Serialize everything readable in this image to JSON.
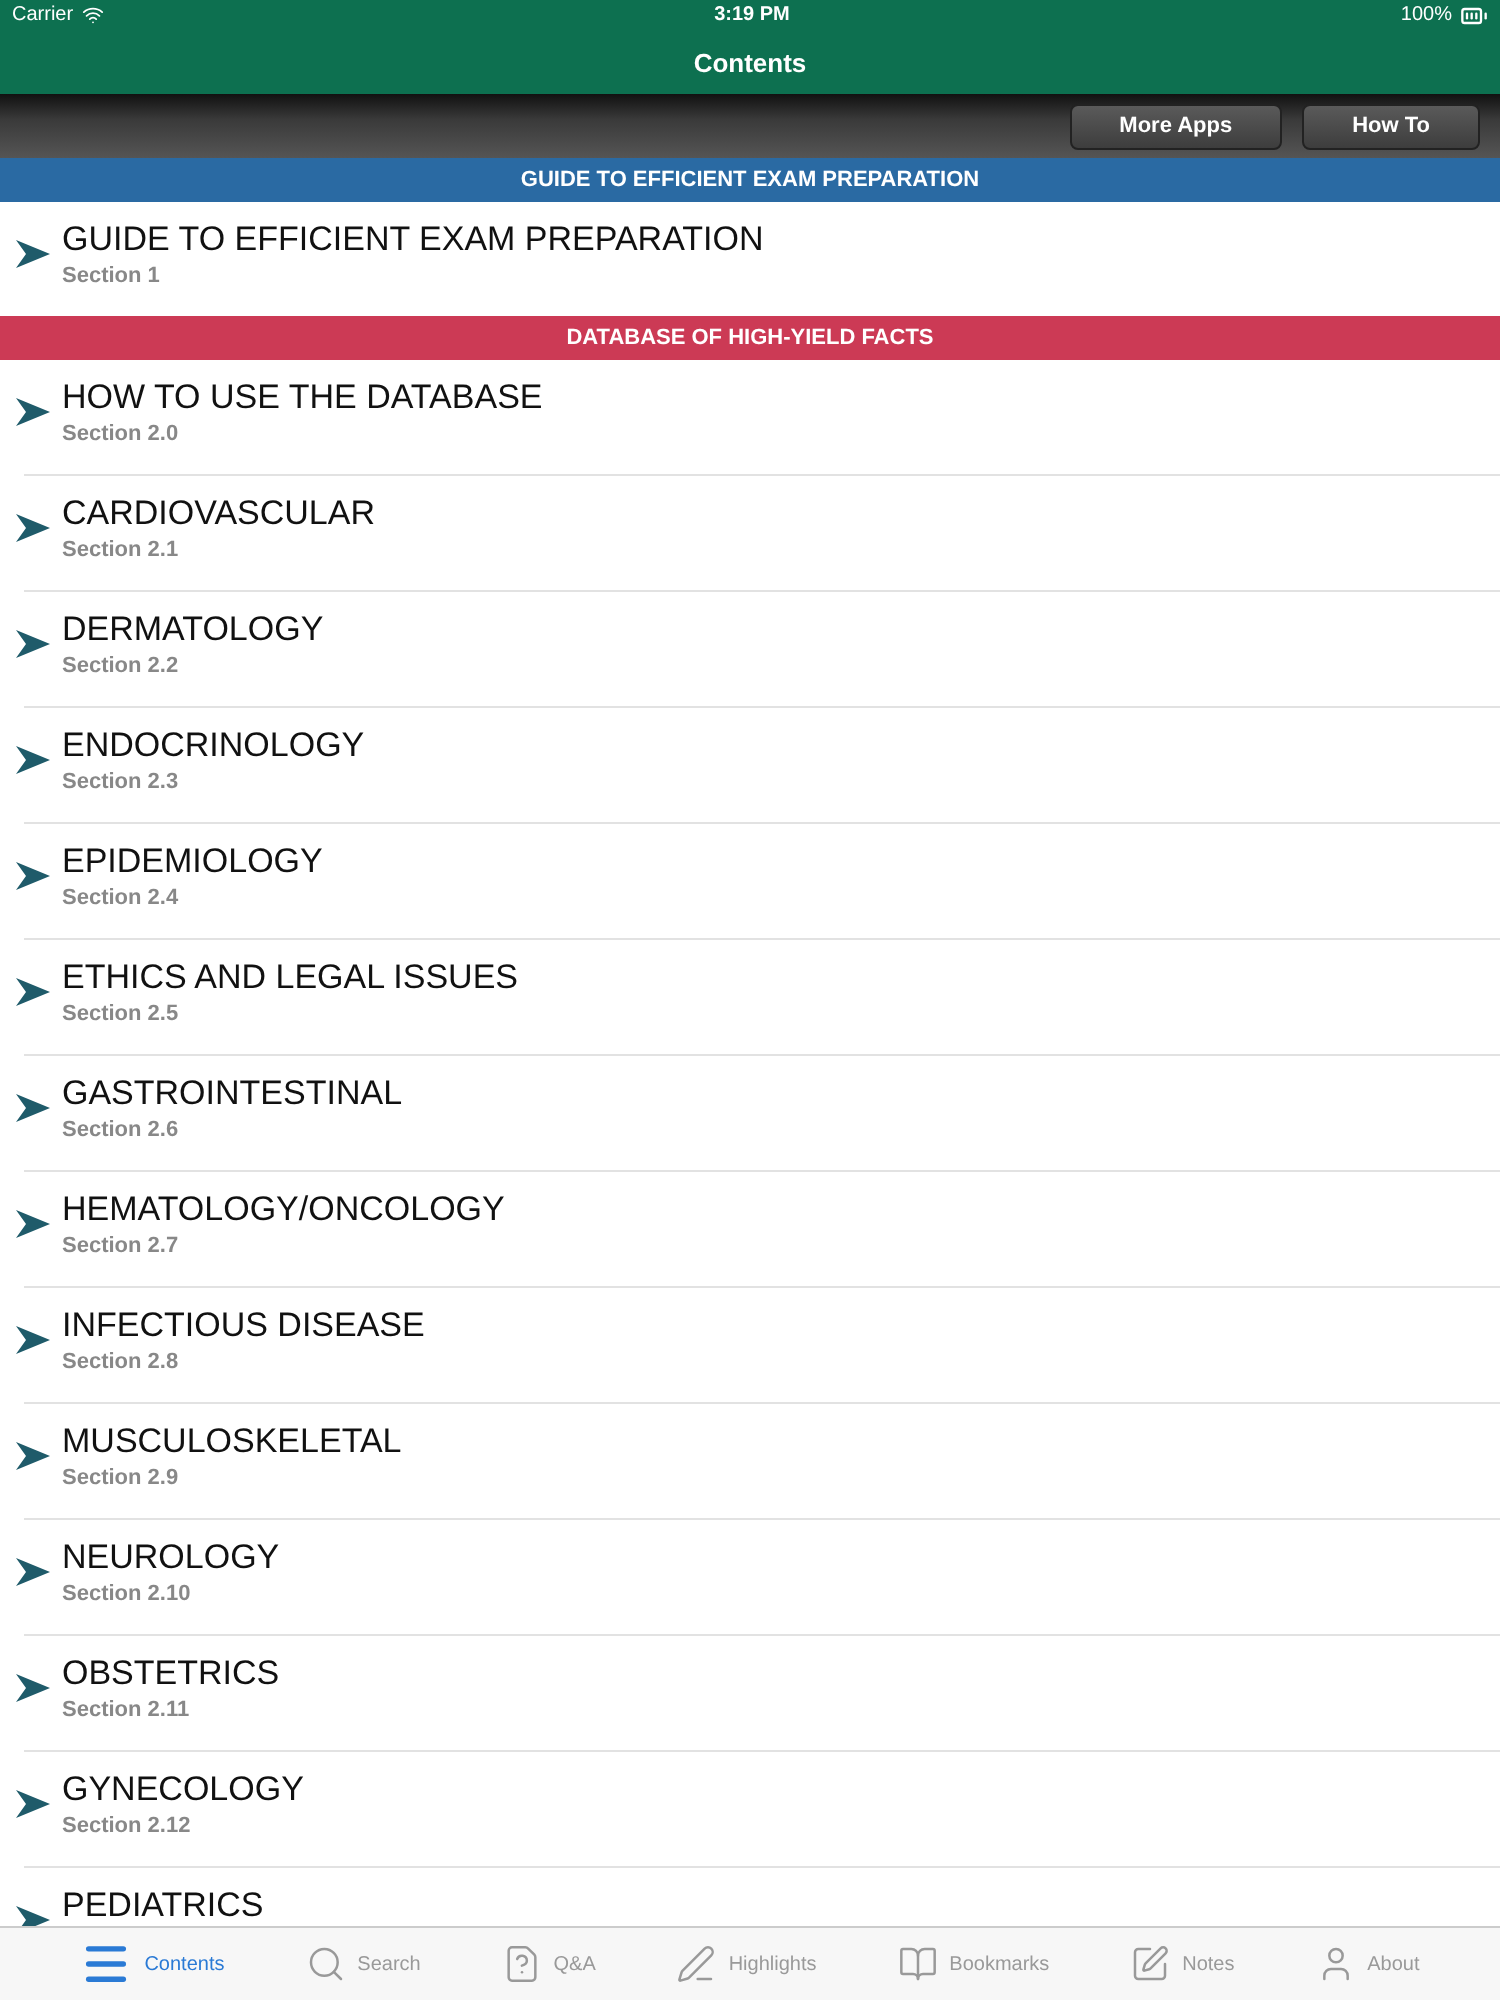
{
  "status_bar": {
    "carrier": "Carrier",
    "time": "3:19 PM",
    "battery": "100%"
  },
  "nav": {
    "title": "Contents"
  },
  "toolbar": {
    "buttons": [
      "More Apps",
      "How To"
    ]
  },
  "sections": [
    {
      "header": "GUIDE TO EFFICIENT EXAM PREPARATION",
      "color": "#2a6aa3",
      "items": [
        {
          "title": "GUIDE TO EFFICIENT EXAM PREPARATION",
          "subtitle": "Section 1"
        }
      ]
    },
    {
      "header": "DATABASE OF HIGH-YIELD FACTS",
      "color": "#cc3a55",
      "items": [
        {
          "title": "HOW TO USE THE DATABASE",
          "subtitle": "Section 2.0"
        },
        {
          "title": "CARDIOVASCULAR",
          "subtitle": "Section 2.1"
        },
        {
          "title": "DERMATOLOGY",
          "subtitle": "Section 2.2"
        },
        {
          "title": "ENDOCRINOLOGY",
          "subtitle": "Section 2.3"
        },
        {
          "title": "EPIDEMIOLOGY",
          "subtitle": "Section 2.4"
        },
        {
          "title": "ETHICS AND LEGAL ISSUES",
          "subtitle": "Section 2.5"
        },
        {
          "title": "GASTROINTESTINAL",
          "subtitle": "Section 2.6"
        },
        {
          "title": "HEMATOLOGY/ONCOLOGY",
          "subtitle": "Section 2.7"
        },
        {
          "title": "INFECTIOUS DISEASE",
          "subtitle": "Section 2.8"
        },
        {
          "title": "MUSCULOSKELETAL",
          "subtitle": "Section 2.9"
        },
        {
          "title": "NEUROLOGY",
          "subtitle": "Section 2.10"
        },
        {
          "title": "OBSTETRICS",
          "subtitle": "Section 2.11"
        },
        {
          "title": "GYNECOLOGY",
          "subtitle": "Section 2.12"
        },
        {
          "title": "PEDIATRICS"
        }
      ]
    }
  ],
  "tab_bar": [
    {
      "kind": "contents",
      "label": "Contents",
      "selected": true
    },
    {
      "kind": "search",
      "label": "Search",
      "selected": false
    },
    {
      "kind": "qa",
      "label": "Q&A",
      "selected": false
    },
    {
      "kind": "highlights",
      "label": "Highlights",
      "selected": false
    },
    {
      "kind": "bookmarks",
      "label": "Bookmarks",
      "selected": false
    },
    {
      "kind": "notes",
      "label": "Notes",
      "selected": false
    },
    {
      "kind": "about",
      "label": "About",
      "selected": false
    }
  ]
}
